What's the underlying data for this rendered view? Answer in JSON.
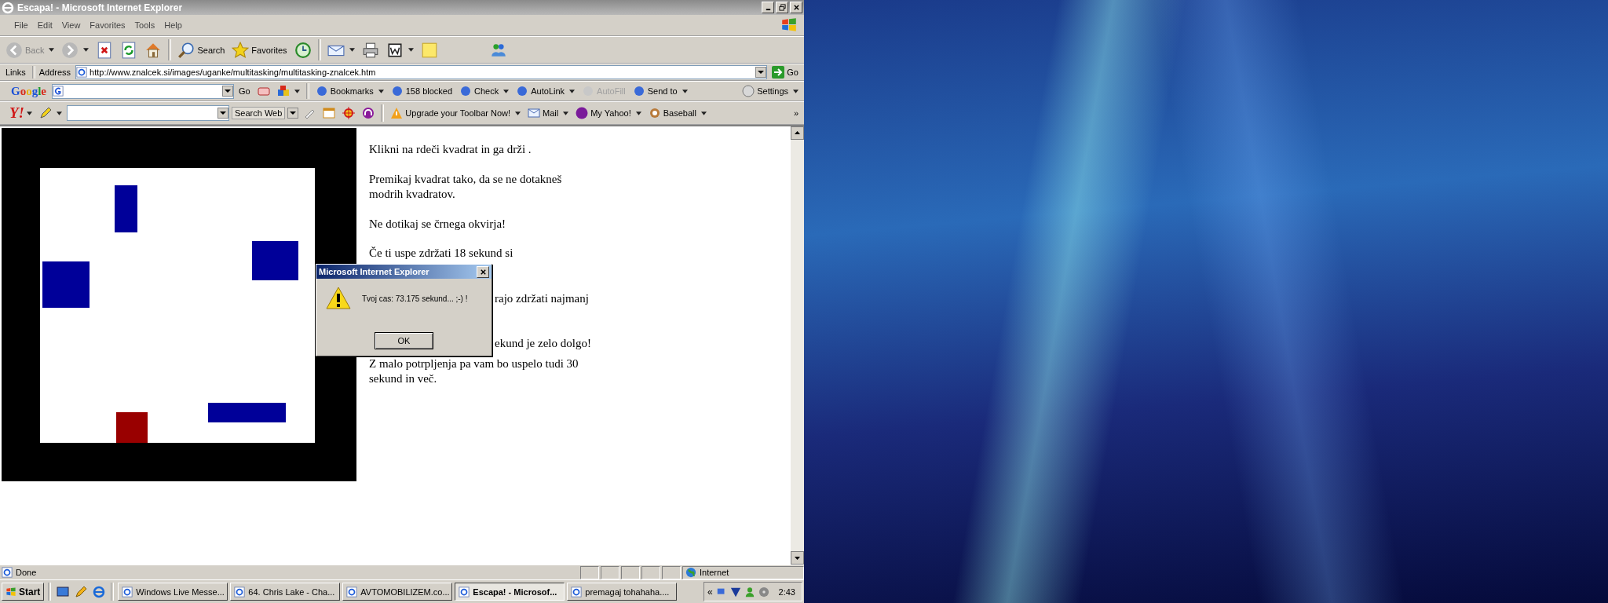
{
  "window": {
    "title": "Escapa! - Microsoft Internet Explorer"
  },
  "menu": [
    "File",
    "Edit",
    "View",
    "Favorites",
    "Tools",
    "Help"
  ],
  "toolbar": {
    "back": "Back",
    "search": "Search",
    "favorites": "Favorites"
  },
  "address_bar": {
    "links": "Links",
    "label": "Address",
    "url": "http://www.znalcek.si/images/uganke/multitasking/multitasking-znalcek.htm",
    "go": "Go"
  },
  "google_toolbar": {
    "logo": "Google",
    "go": "Go",
    "items": [
      {
        "label": "Bookmarks",
        "kind": "menu",
        "disabled": false
      },
      {
        "label": "158 blocked",
        "kind": "button",
        "disabled": false
      },
      {
        "label": "Check",
        "kind": "menu",
        "disabled": false
      },
      {
        "label": "AutoLink",
        "kind": "menu",
        "disabled": false
      },
      {
        "label": "AutoFill",
        "kind": "button",
        "disabled": true
      },
      {
        "label": "Send to",
        "kind": "menu",
        "disabled": false
      }
    ],
    "settings": "Settings"
  },
  "yahoo_toolbar": {
    "logo": "Y!",
    "search_web": "Search Web",
    "items": [
      {
        "label": "Upgrade your Toolbar Now!",
        "kind": "warning"
      },
      {
        "label": "Mail",
        "kind": "mail"
      },
      {
        "label": "My Yahoo!",
        "kind": "my"
      },
      {
        "label": "Baseball",
        "kind": "ball"
      }
    ],
    "more": "»"
  },
  "page": {
    "paragraphs": [
      {
        "kind": "plain",
        "lines": [
          "Klikni na rdeči kvadrat in ga drži ."
        ]
      },
      {
        "kind": "plain",
        "lines": [
          "Premikaj kvadrat tako, da se ne dotakneš",
          "modrih kvadratov."
        ]
      },
      {
        "kind": "plain",
        "lines": [
          "Ne dotikaj se črnega okvirja!"
        ]
      },
      {
        "kind": "plain",
        "lines": [
          "Če ti uspe zdržati 18 sekund si"
        ]
      },
      {
        "kind": "covered",
        "lines": [
          "rajo zdržati najmanj"
        ]
      },
      {
        "kind": "covered",
        "lines": [
          "ekund je zelo dolgo!"
        ]
      },
      {
        "kind": "plain",
        "lines": [
          "Z malo potrpljenja pa vam bo uspelo tudi 30",
          "sekund in več."
        ]
      }
    ]
  },
  "dialog": {
    "title": "Microsoft Internet Explorer",
    "message": "Tvoj cas: 73.175 sekund... ;-) !",
    "button": "OK"
  },
  "status_bar": {
    "text": "Done",
    "zone": "Internet"
  },
  "taskbar": {
    "start": "Start",
    "tasks": [
      {
        "label": "Windows Live Messe...",
        "selected": false
      },
      {
        "label": "64. Chris Lake - Cha...",
        "selected": false
      },
      {
        "label": "AVTOMOBILIZEM.co...",
        "selected": false
      },
      {
        "label": "Escapa! - Microsof...",
        "selected": true
      },
      {
        "label": "premagaj tohahaha....",
        "selected": false
      }
    ],
    "tray_toggle": "«",
    "clock": "2:43"
  }
}
